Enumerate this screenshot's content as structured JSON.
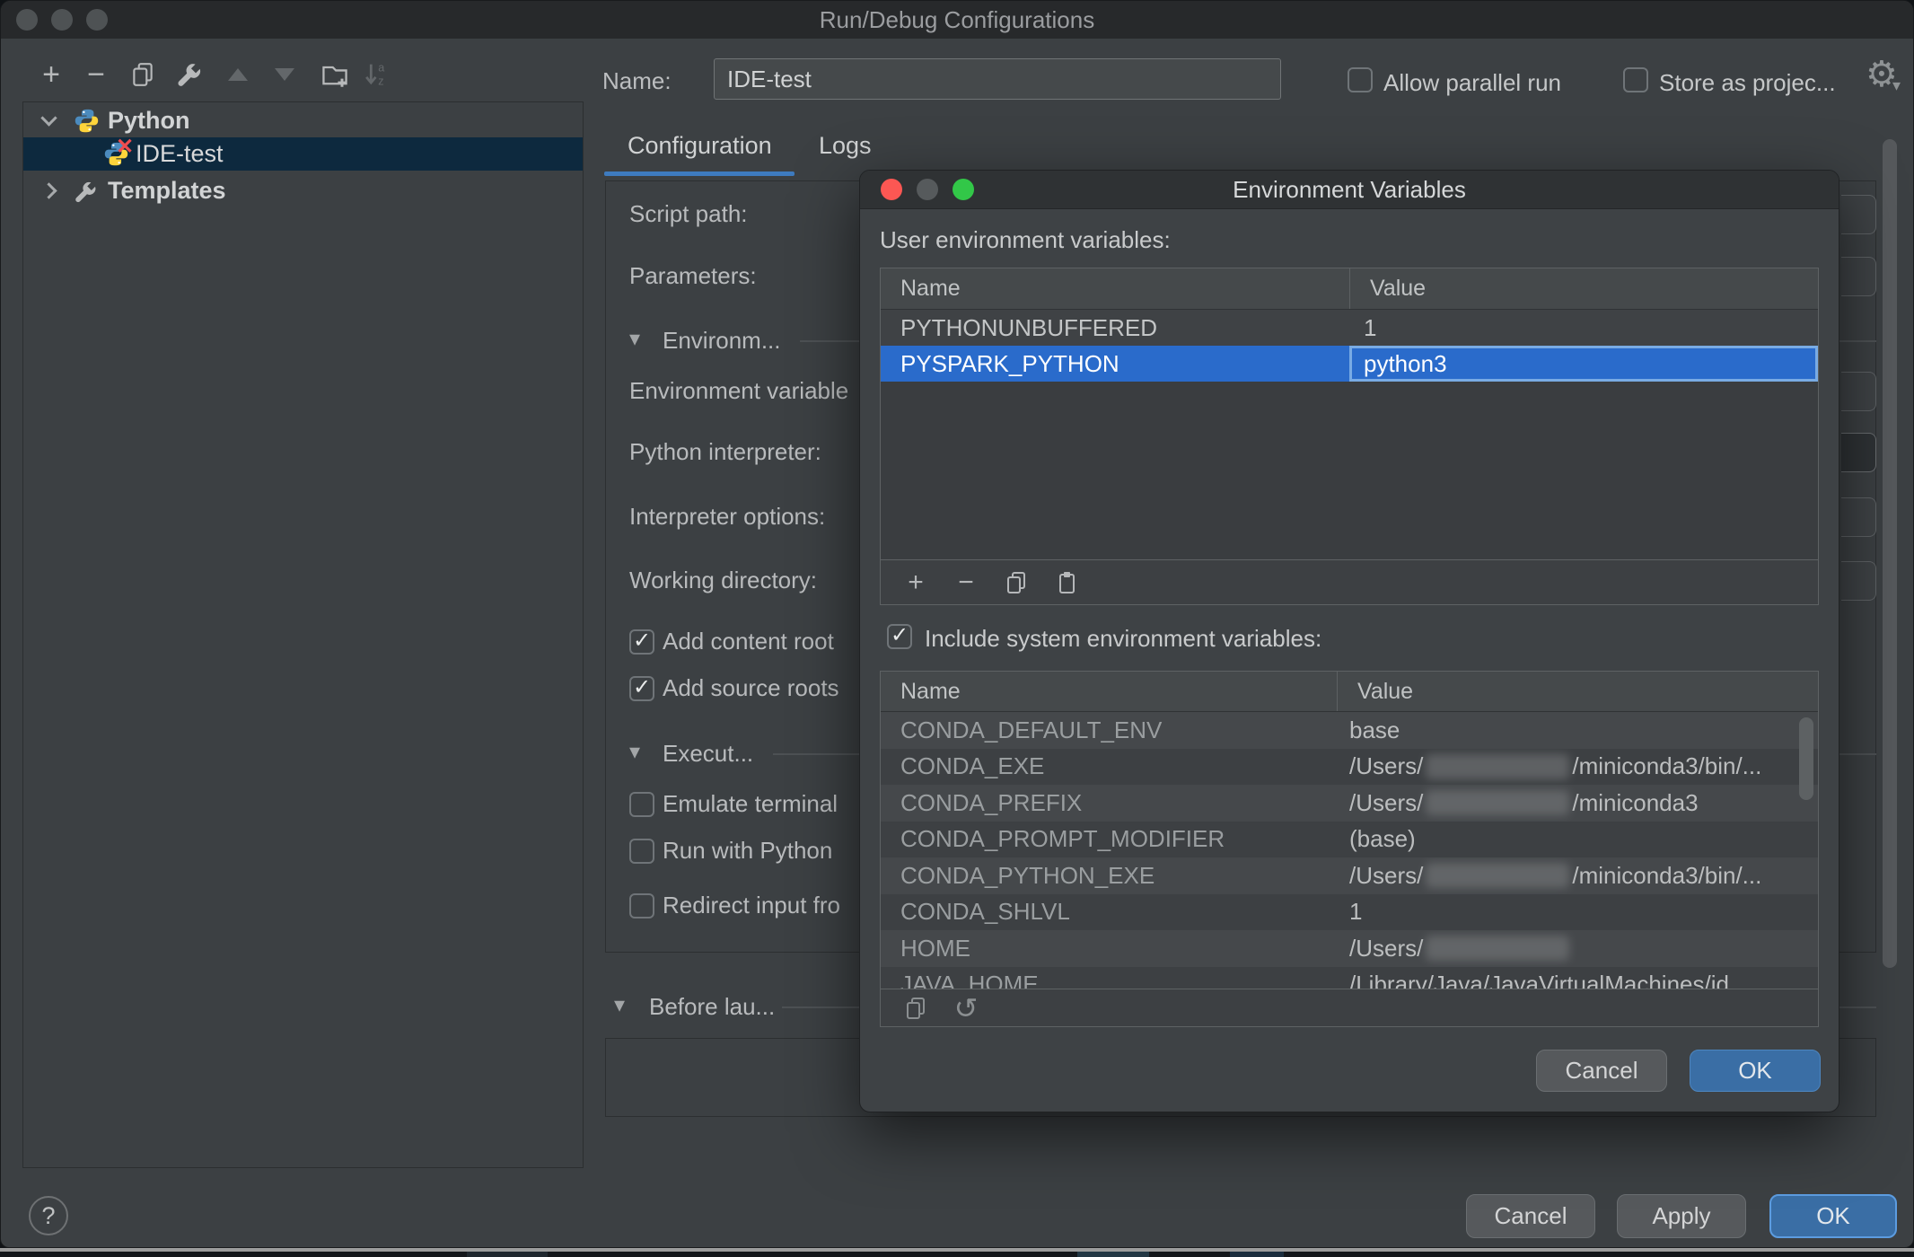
{
  "window": {
    "title": "Run/Debug Configurations"
  },
  "icons": {
    "plus": "+",
    "minus": "−",
    "check": "✓",
    "gear": "⚙",
    "undo": "↺",
    "section_arrow": "▾",
    "gear_caret": "▾",
    "sort_a": "a",
    "sort_z": "z"
  },
  "toolbar": {
    "icons": [
      "add",
      "remove",
      "copy",
      "edit-templates",
      "move-up",
      "move-down",
      "new-folder",
      "sort-alphabetically"
    ]
  },
  "sidebar": {
    "tree": [
      {
        "label": "Python",
        "type": "group",
        "expanded": true
      },
      {
        "label": "IDE-test",
        "selected": true,
        "invalid": true
      },
      {
        "label": "Templates",
        "type": "group",
        "expanded": false
      }
    ]
  },
  "header": {
    "name_label": "Name:",
    "name_value": "IDE-test",
    "allow_parallel_label": "Allow parallel run",
    "allow_parallel_checked": false,
    "store_as_label": "Store as projec...",
    "store_as_checked": false
  },
  "tabs": [
    {
      "label": "Configuration",
      "active": true
    },
    {
      "label": "Logs",
      "active": false
    }
  ],
  "form": {
    "script_path_label": "Script path:",
    "parameters_label": "Parameters:",
    "environment_section_label": "Environm...",
    "environment_variables_label": "Environment variable",
    "python_interpreter_label": "Python interpreter:",
    "interpreter_options_label": "Interpreter options:",
    "working_directory_label": "Working directory:",
    "add_content_roots_label": "Add content root",
    "add_content_roots_checked": true,
    "add_source_roots_label": "Add source roots",
    "add_source_roots_checked": true,
    "execution_section_label": "Execut...",
    "emulate_terminal_label": "Emulate terminal",
    "emulate_terminal_checked": false,
    "run_with_python_label": "Run with Python",
    "run_with_python_checked": false,
    "redirect_input_label": "Redirect input fro",
    "redirect_input_checked": false,
    "before_launch_section_label": "Before lau..."
  },
  "dialog": {
    "title": "Environment Variables",
    "user_vars_label": "User environment variables:",
    "user_columns": {
      "name": "Name",
      "value": "Value"
    },
    "user_vars": [
      {
        "name": "PYTHONUNBUFFERED",
        "value": "1",
        "selected": false
      },
      {
        "name": "PYSPARK_PYTHON",
        "value": "python3",
        "selected": true,
        "editing": true
      }
    ],
    "include_system_label": "Include system environment variables:",
    "include_system_checked": true,
    "system_columns": {
      "name": "Name",
      "value": "Value"
    },
    "system_vars": [
      {
        "name": "CONDA_DEFAULT_ENV",
        "value_prefix": "base",
        "redacted": false,
        "value_suffix": ""
      },
      {
        "name": "CONDA_EXE",
        "value_prefix": "/Users/",
        "redacted": true,
        "value_suffix": "/miniconda3/bin/..."
      },
      {
        "name": "CONDA_PREFIX",
        "value_prefix": "/Users/",
        "redacted": true,
        "value_suffix": "/miniconda3"
      },
      {
        "name": "CONDA_PROMPT_MODIFIER",
        "value_prefix": "(base)",
        "redacted": false,
        "value_suffix": ""
      },
      {
        "name": "CONDA_PYTHON_EXE",
        "value_prefix": "/Users/",
        "redacted": true,
        "value_suffix": "/miniconda3/bin/..."
      },
      {
        "name": "CONDA_SHLVL",
        "value_prefix": "1",
        "redacted": false,
        "value_suffix": ""
      },
      {
        "name": "HOME",
        "value_prefix": "/Users/",
        "redacted": true,
        "value_suffix": ""
      },
      {
        "name": "JAVA_HOME",
        "value_prefix": "/Library/Java/JavaVirtualMachines/jd",
        "redacted": false,
        "value_suffix": ""
      }
    ],
    "cancel_label": "Cancel",
    "ok_label": "OK"
  },
  "footer": {
    "help_label": "?",
    "cancel_label": "Cancel",
    "apply_label": "Apply",
    "ok_label": "OK"
  },
  "colors": {
    "selection_blue": "#2a6bcb",
    "tree_selection": "#0d293e",
    "tab_accent": "#3e7bbf",
    "primary_button": "#3a6ea5",
    "traffic_red": "#fc5753",
    "traffic_gray": "#565a5c",
    "traffic_green": "#32c748"
  }
}
